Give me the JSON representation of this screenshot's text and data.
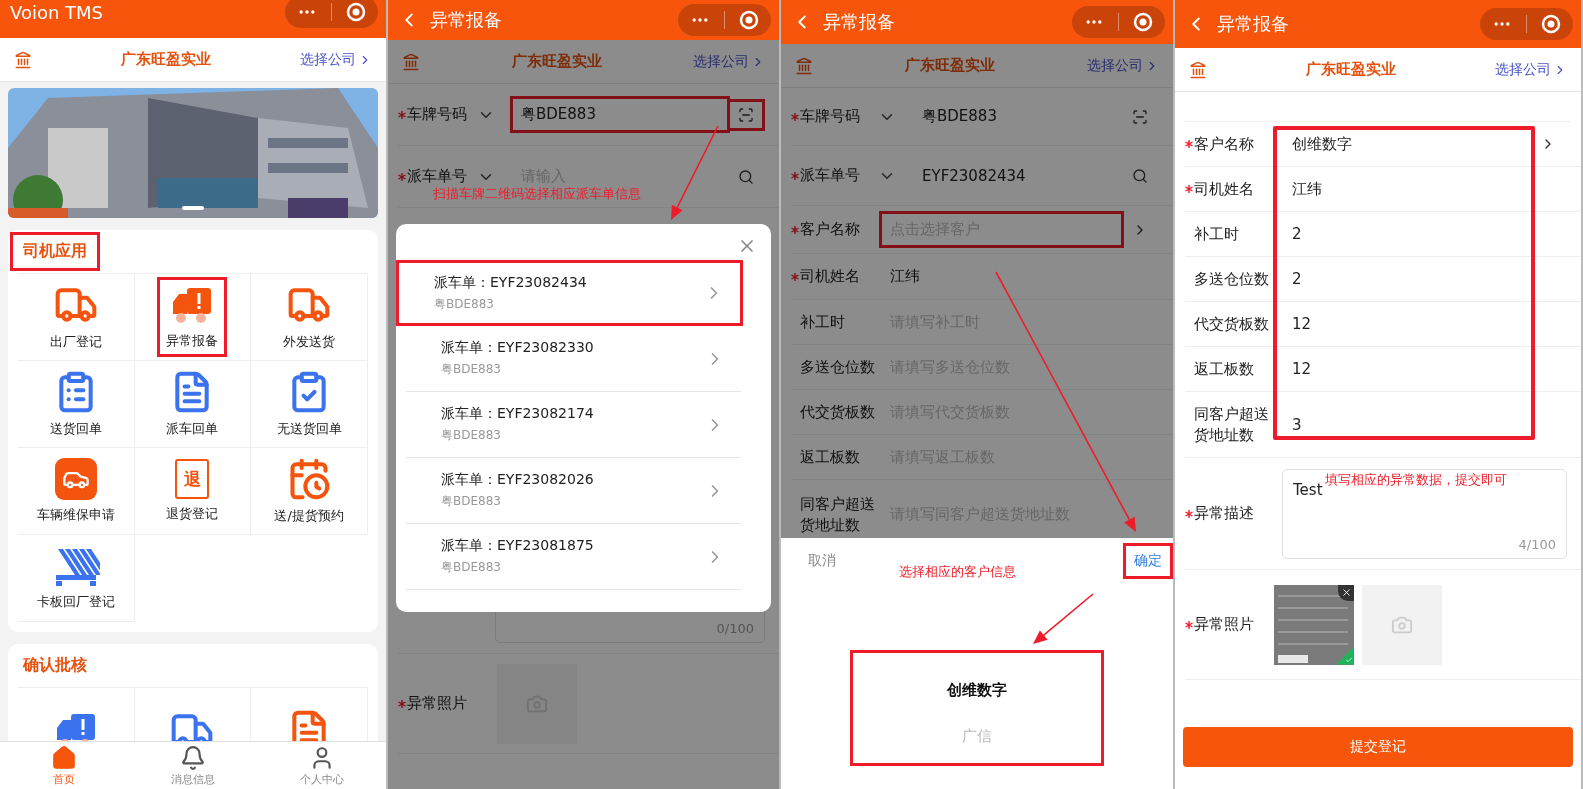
{
  "home": {
    "title": "Voion TMS",
    "company": "广东旺盈实业",
    "switch_company": "选择公司",
    "sections": [
      {
        "title": "司机应用",
        "highlighted": true,
        "apps": [
          {
            "label": "出厂登记",
            "kind": "truck",
            "color": "#f5540f",
            "highlighted": false
          },
          {
            "label": "异常报备",
            "kind": "alert-truck",
            "color": "#f5540f",
            "highlighted": true
          },
          {
            "label": "外发送货",
            "kind": "delivery-truck",
            "color": "#f5540f",
            "highlighted": false
          },
          {
            "label": "送货回单",
            "kind": "receipt",
            "color": "#3b72ee",
            "highlighted": false
          },
          {
            "label": "派车回单",
            "kind": "dispatch-receipt",
            "color": "#3b72ee",
            "highlighted": false
          },
          {
            "label": "无送货回单",
            "kind": "return-receipt",
            "color": "#3b72ee",
            "highlighted": false
          },
          {
            "label": "车辆维保申请",
            "kind": "car-service",
            "color": "#f5540f",
            "highlighted": false
          },
          {
            "label": "退货登记",
            "kind": "return-slip",
            "icon_text": "退",
            "color": "#f5540f",
            "highlighted": false
          },
          {
            "label": "送/提货预约",
            "kind": "calendar",
            "color": "#f5540f",
            "highlighted": false
          },
          {
            "label": "卡板回厂登记",
            "kind": "pallet",
            "color": "#3b72ee",
            "highlighted": false
          }
        ]
      },
      {
        "title": "确认批核",
        "highlighted": false,
        "apps": [
          {
            "kind": "alert-truck",
            "color": "#3b72ee",
            "highlighted": false
          },
          {
            "kind": "check-truck",
            "color": "#3b72ee",
            "highlighted": false
          },
          {
            "kind": "document",
            "color": "#f5540f",
            "highlighted": false
          }
        ]
      }
    ],
    "tabs": [
      {
        "label": "首页",
        "kind": "home",
        "selected": true
      },
      {
        "label": "消息信息",
        "kind": "bell",
        "selected": false
      },
      {
        "label": "个人中心",
        "kind": "user",
        "selected": false
      }
    ]
  },
  "scan_screen": {
    "title": "异常报备",
    "company": "广东旺盈实业",
    "switch_company": "选择公司",
    "fields": [
      {
        "label": "车牌号码",
        "required": true,
        "dropdown": true,
        "value": "粤BDE883",
        "scan_button": true,
        "search_button": false,
        "chevron": false,
        "highlighted": true
      },
      {
        "label": "派车单号",
        "required": true,
        "dropdown": true,
        "placeholder": "请输入",
        "scan_button": false,
        "search_button": true,
        "chevron": false,
        "highlighted": false
      }
    ],
    "note": "扫描车牌二维码选择相应派车单信息",
    "description_counter": "0/100",
    "photo_label": "异常照片",
    "photo_required": true,
    "dispatch_list": [
      {
        "title": "派车单：EYF23082434",
        "plate": "粤BDE883",
        "highlighted": true
      },
      {
        "title": "派车单：EYF23082330",
        "plate": "粤BDE883",
        "highlighted": false
      },
      {
        "title": "派车单：EYF23082174",
        "plate": "粤BDE883",
        "highlighted": false
      },
      {
        "title": "派车单：EYF23082026",
        "plate": "粤BDE883",
        "highlighted": false
      },
      {
        "title": "派车单：EYF23081875",
        "plate": "粤BDE883",
        "highlighted": false
      }
    ]
  },
  "customer_screen": {
    "title": "异常报备",
    "company": "广东旺盈实业",
    "switch_company": "选择公司",
    "fields": [
      {
        "label": "车牌号码",
        "required": true,
        "dropdown": true,
        "value": "粤BDE883",
        "scan_button": true,
        "search_button": false,
        "chevron": false,
        "highlighted": false
      },
      {
        "label": "派车单号",
        "required": true,
        "dropdown": true,
        "value": "EYF23082434",
        "scan_button": false,
        "search_button": true,
        "chevron": false,
        "highlighted": false
      },
      {
        "label": "客户名称",
        "required": true,
        "dropdown": false,
        "placeholder": "点击选择客户",
        "scan_button": false,
        "search_button": false,
        "chevron": true,
        "highlighted": true
      },
      {
        "label": "司机姓名",
        "required": true,
        "dropdown": false,
        "value": "江纬",
        "scan_button": false,
        "search_button": false,
        "chevron": false,
        "highlighted": false
      },
      {
        "label": "补工时",
        "required": false,
        "dropdown": false,
        "placeholder": "请填写补工时",
        "scan_button": false,
        "search_button": false,
        "chevron": false,
        "highlighted": false
      },
      {
        "label": "多送仓位数",
        "required": false,
        "dropdown": false,
        "placeholder": "请填写多送仓位数",
        "scan_button": false,
        "search_button": false,
        "chevron": false,
        "highlighted": false
      },
      {
        "label": "代交货板数",
        "required": false,
        "dropdown": false,
        "placeholder": "请填写代交货板数",
        "scan_button": false,
        "search_button": false,
        "chevron": false,
        "highlighted": false
      },
      {
        "label": "返工板数",
        "required": false,
        "dropdown": false,
        "placeholder": "请填写返工板数",
        "scan_button": false,
        "search_button": false,
        "chevron": false,
        "highlighted": false
      },
      {
        "label": "同客户超送货地址数",
        "required": false,
        "dropdown": false,
        "placeholder": "请填写同客户超送货地址数",
        "scan_button": false,
        "search_button": false,
        "chevron": false,
        "highlighted": false
      }
    ],
    "picker": {
      "cancel": "取消",
      "confirm": "确定",
      "confirm_highlighted": true,
      "options_highlighted": true,
      "note": "选择相应的客户信息",
      "options": [
        {
          "label": "创维数字",
          "selected": true
        },
        {
          "label": "广信",
          "selected": false
        }
      ]
    }
  },
  "filled_screen": {
    "title": "异常报备",
    "company": "广东旺盈实业",
    "switch_company": "选择公司",
    "values_highlighted": true,
    "fields": [
      {
        "label": "客户名称",
        "required": true,
        "value": "创维数字",
        "chevron": true
      },
      {
        "label": "司机姓名",
        "required": true,
        "value": "江纬",
        "chevron": false
      },
      {
        "label": "补工时",
        "required": false,
        "value": "2",
        "chevron": false
      },
      {
        "label": "多送仓位数",
        "required": false,
        "value": "2",
        "chevron": false
      },
      {
        "label": "代交货板数",
        "required": false,
        "value": "12",
        "chevron": false
      },
      {
        "label": "返工板数",
        "required": false,
        "value": "12",
        "chevron": false
      },
      {
        "label": "同客户超送货地址数",
        "required": false,
        "value": "3",
        "chevron": false
      }
    ],
    "description": {
      "label": "异常描述",
      "required": true,
      "value": "Test",
      "counter": "4/100",
      "note": "填写相应的异常数据，提交即可"
    },
    "photos": {
      "label": "异常照片",
      "required": true,
      "items": [
        {
          "kind": "uploaded"
        },
        {
          "kind": "add"
        }
      ]
    },
    "submit": "提交登记"
  }
}
